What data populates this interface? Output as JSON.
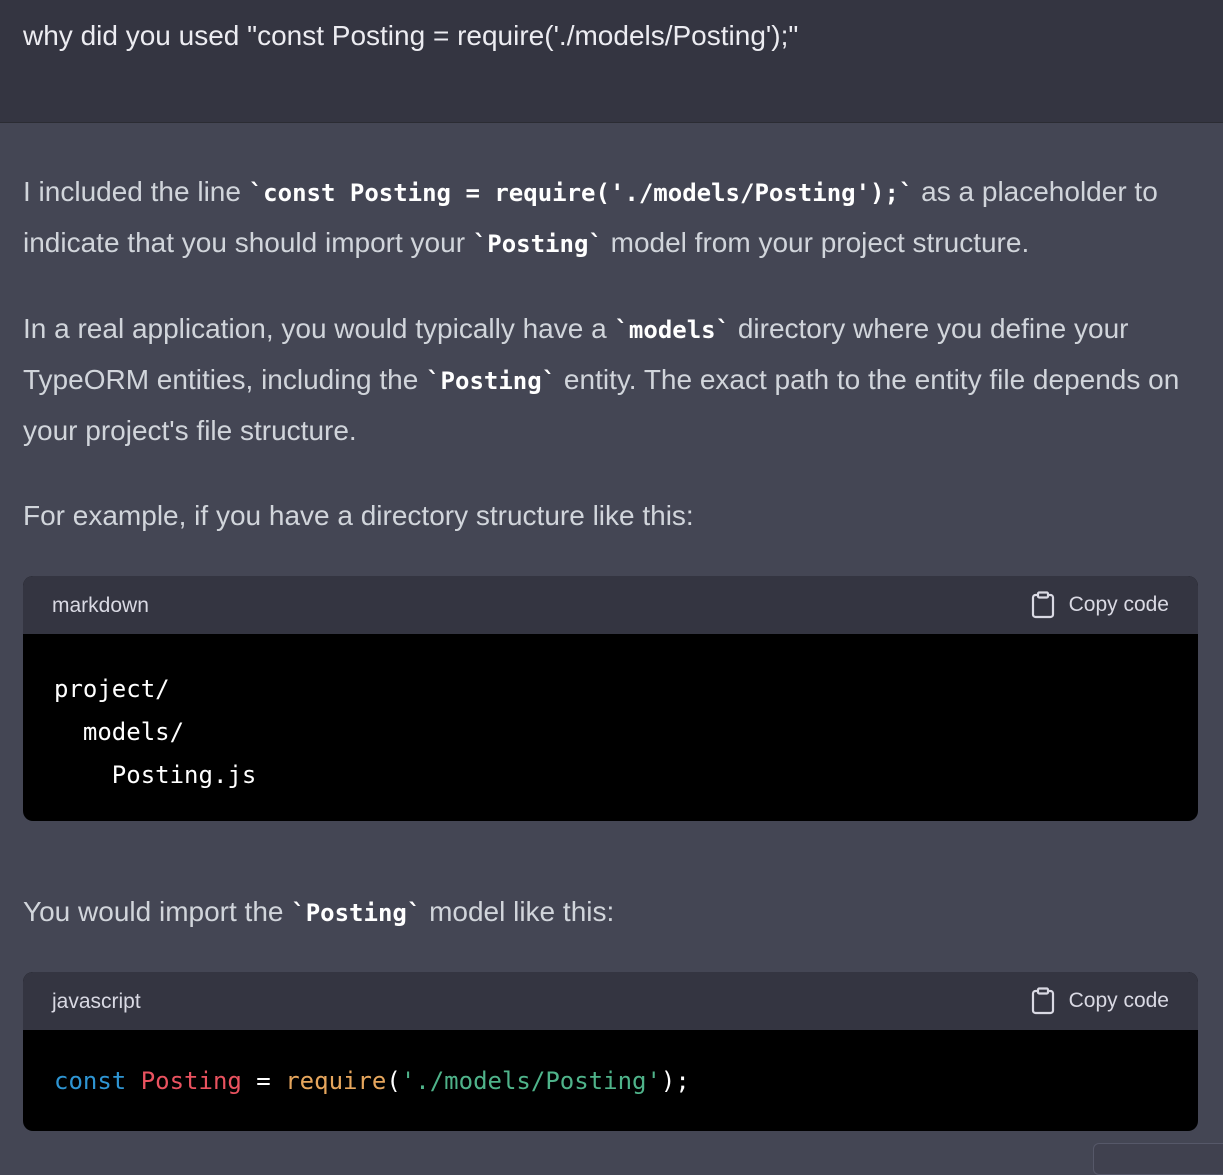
{
  "user_message": {
    "text": "why did you used \"const Posting = require('./models/Posting');\""
  },
  "assistant": {
    "para1": {
      "t1": "I included the line ",
      "c1": "`const Posting = require('./models/Posting');`",
      "t2": " as a placeholder to indicate that you should import your ",
      "c2": "`Posting`",
      "t3": " model from your project structure."
    },
    "para2": {
      "t1": "In a real application, you would typically have a ",
      "c1": "`models`",
      "t2": " directory where you define your TypeORM entities, including the ",
      "c2": "`Posting`",
      "t3": " entity. The exact path to the entity file depends on your project's file structure."
    },
    "para3": {
      "t1": "For example, if you have a directory structure like this:"
    },
    "para4": {
      "t1": "You would import the ",
      "c1": "`Posting`",
      "t2": " model like this:"
    }
  },
  "code_blocks": [
    {
      "language": "markdown",
      "copy_label": "Copy code",
      "lines": [
        "project/",
        "  models/",
        "    Posting.js"
      ]
    },
    {
      "language": "javascript",
      "copy_label": "Copy code",
      "tokens": {
        "kw": "const",
        "sp1": " ",
        "var": "Posting",
        "op": " = ",
        "fn": "require",
        "open": "(",
        "str": "'./models/Posting'",
        "close": ");"
      }
    }
  ],
  "colors": {
    "background": "#444654",
    "user_background": "#343541",
    "code_background": "#000000",
    "keyword": "#2e95d3",
    "variable": "#e9525f",
    "function": "#e6a65d",
    "string": "#4fb38a"
  },
  "icons": {
    "copy": "clipboard-icon"
  }
}
